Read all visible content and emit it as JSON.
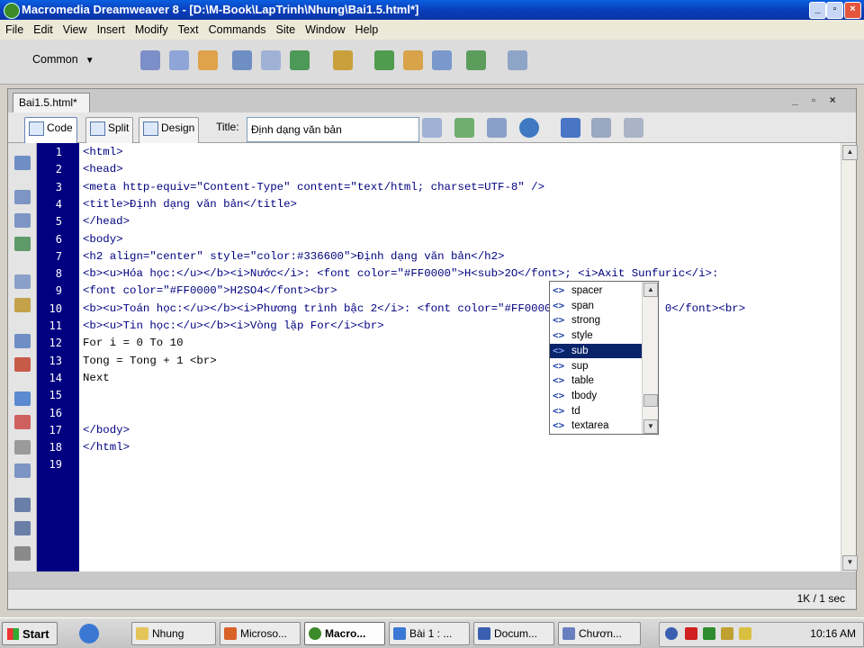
{
  "window": {
    "title": "Macromedia Dreamweaver 8 - [D:\\M-Book\\LapTrinh\\Nhung\\Bai1.5.html*]",
    "controls": [
      "_",
      "▫",
      "×"
    ]
  },
  "menubar": [
    "File",
    "Edit",
    "View",
    "Insert",
    "Modify",
    "Text",
    "Commands",
    "Site",
    "Window",
    "Help"
  ],
  "insert_toolbar": {
    "category": "Common"
  },
  "document": {
    "tab_label": "Bai1.5.html*",
    "controls_text": "_ ▫ ×",
    "views": {
      "code": "Code",
      "split": "Split",
      "design": "Design"
    },
    "title_label": "Title:",
    "title_value": "Định dạng văn bản"
  },
  "code_lines": [
    "<html>",
    "<head>",
    "<meta http-equiv=\"Content-Type\" content=\"text/html; charset=UTF-8\" />",
    "<title>Định dạng văn bản</title>",
    "</head>",
    "<body>",
    "<h2 align=\"center\" style=\"color:#336600\">Định dạng văn bản</h2>",
    "<b><u>Hóa học:</u></b><i>Nước</i>: <font color=\"#FF0000\">H<sub>2O</font>; <i>Axit Sunfuric</i>:",
    "<font color=\"#FF0000\">H2SO4</font><br>",
    "<b><u>Toán học:</u></b><i>Phương trình bậc 2</i>: <font color=\"#FF0000\">ax2 + bx + c = 0</font><br>",
    "<b><u>Tin học:</u></b><i>Vòng lặp For</i><br>",
    "For i = 0 To 10",
    "Tong = Tong + 1 <br>",
    "Next",
    "",
    "",
    "</body>",
    "</html>",
    ""
  ],
  "autocomplete": {
    "items": [
      "spacer",
      "span",
      "strong",
      "style",
      "sub",
      "sup",
      "table",
      "tbody",
      "td",
      "textarea"
    ],
    "selected": "sub",
    "icon_glyph": "<>"
  },
  "status": {
    "download": "1K / 1 sec"
  },
  "taskbar": {
    "start_label": "Start",
    "tasks": [
      "Nhung",
      "Microso...",
      "Macro...",
      "Bài 1 : ...",
      "Docum...",
      "Chươn..."
    ],
    "active_task": "Macro...",
    "clock": "10:16 AM"
  }
}
